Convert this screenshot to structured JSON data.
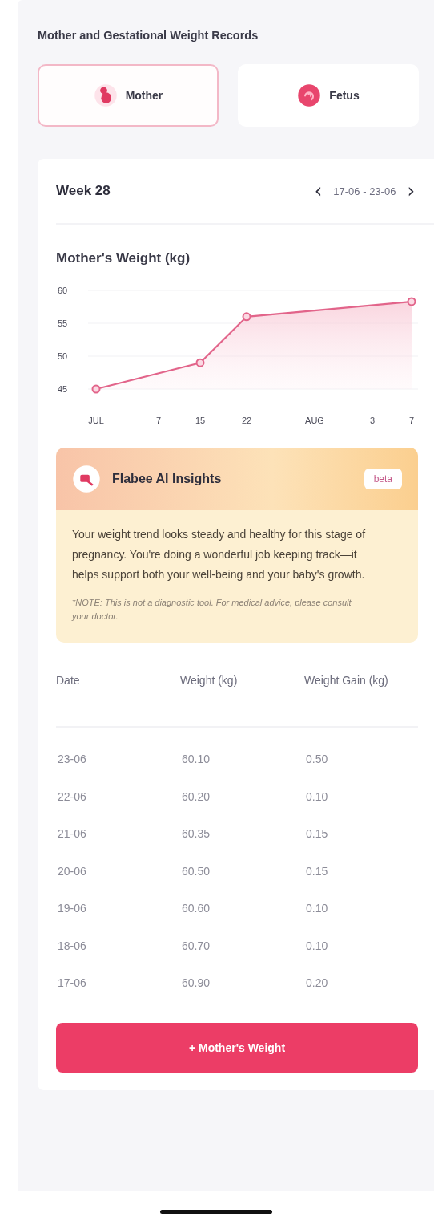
{
  "title": "Mother and Gestational Weight Records",
  "tabs": [
    {
      "label": "Mother",
      "kind": "mother",
      "selected": true
    },
    {
      "label": "Fetus",
      "kind": "fetus",
      "selected": false
    }
  ],
  "week": {
    "label": "Week 28",
    "range": "17-06 - 23-06",
    "prev": "‹",
    "next": "›"
  },
  "chart": {
    "title": "Mother's Weight (kg)",
    "chart_data": {
      "type": "area",
      "categories": [
        "JUL",
        "7",
        "15",
        "22",
        "AUG",
        "3",
        "7"
      ],
      "series": [
        {
          "color": "#e2648a",
          "values": [
            45,
            null,
            49,
            56,
            null,
            null,
            58.3
          ]
        }
      ],
      "ylim": [
        45,
        60
      ],
      "yticks": [
        45,
        50,
        55,
        60
      ]
    }
  },
  "insights": {
    "title": "Flabee AI Insights",
    "badge": "beta",
    "text": "Your weight trend looks steady and healthy for this stage of pregnancy. You're doing a wonderful job keeping track—it helps support both your well-being and your baby's growth.",
    "note": "*NOTE: This is not a diagnostic tool. For medical advice, please consult your doctor."
  },
  "table": {
    "columns": [
      "Date",
      "Weight (kg)",
      "Weight Gain (kg)"
    ],
    "rows": [
      [
        "23-06",
        "60.10",
        "0.50"
      ],
      [
        "22-06",
        "60.20",
        "0.10"
      ],
      [
        "21-06",
        "60.35",
        "0.15"
      ],
      [
        "20-06",
        "60.50",
        "0.15"
      ],
      [
        "19-06",
        "60.60",
        "0.10"
      ],
      [
        "18-06",
        "60.70",
        "0.10"
      ],
      [
        "17-06",
        "60.90",
        "0.20"
      ]
    ]
  },
  "add_button": "+ Mother's Weight"
}
